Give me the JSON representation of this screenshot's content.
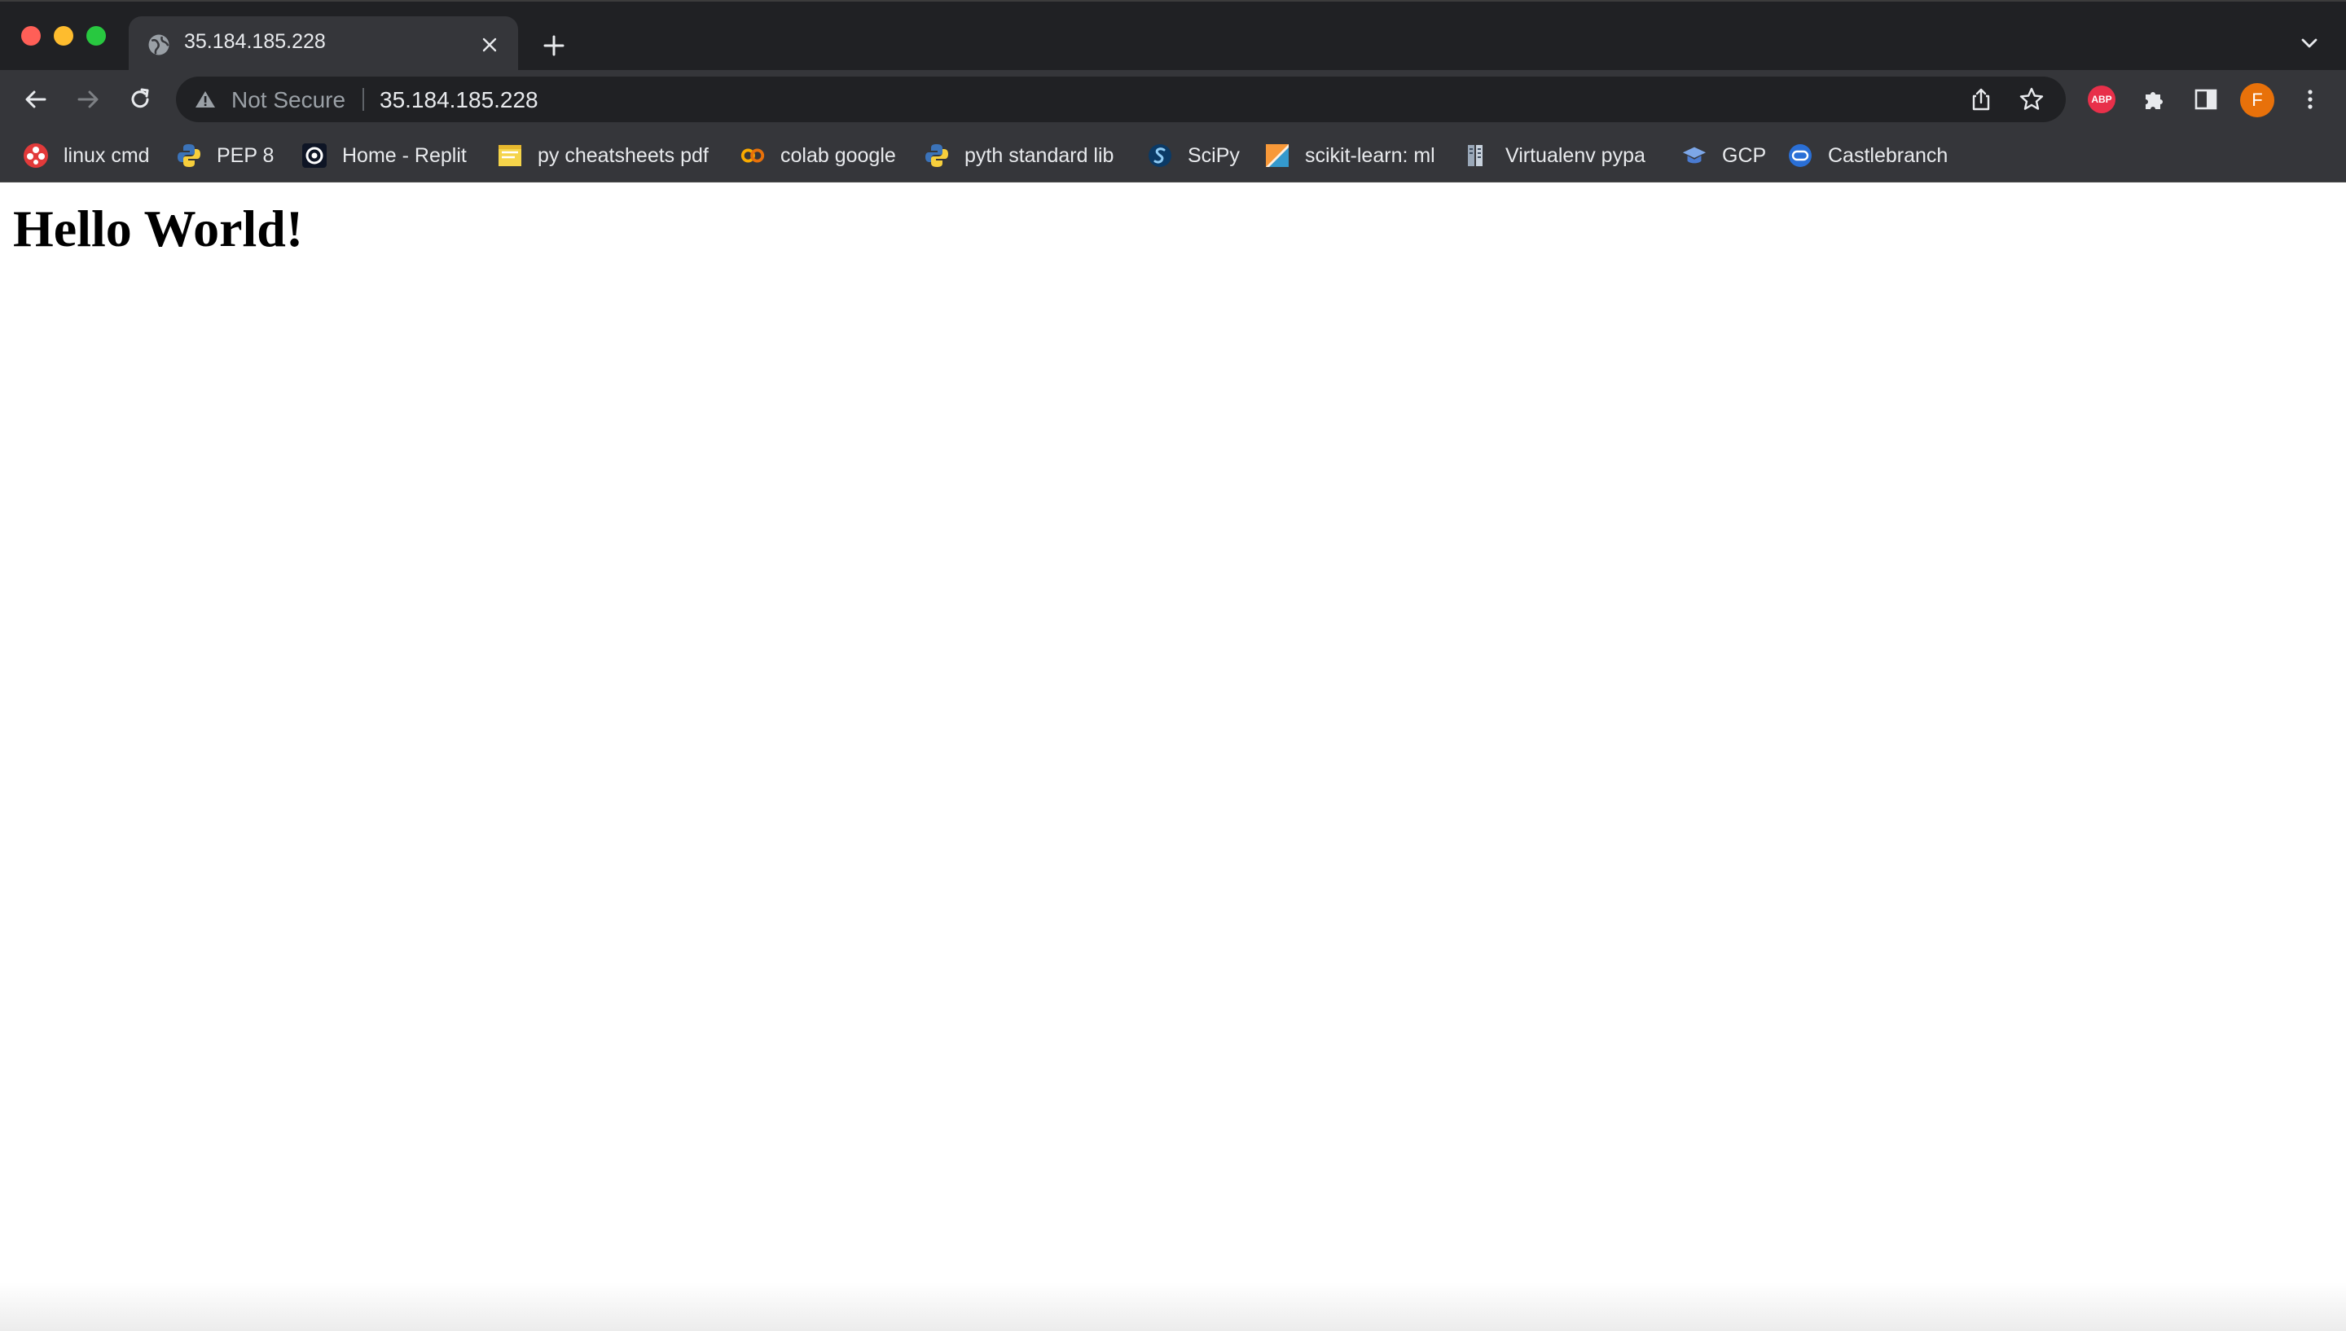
{
  "tab": {
    "title": "35.184.185.228"
  },
  "toolbar": {
    "security_label": "Not Secure",
    "url": "35.184.185.228",
    "extension_abp": "ABP",
    "profile_initial": "F"
  },
  "bookmarks": [
    {
      "label": "linux cmd",
      "icon": "red-flower-icon"
    },
    {
      "label": "PEP 8",
      "icon": "python-icon"
    },
    {
      "label": "Home - Replit",
      "icon": "replit-icon"
    },
    {
      "label": "py cheatsheets pdf",
      "icon": "cheatsheet-icon"
    },
    {
      "label": "colab google",
      "icon": "colab-icon"
    },
    {
      "label": "pyth standard lib",
      "icon": "python-icon"
    },
    {
      "label": "SciPy",
      "icon": "scipy-icon"
    },
    {
      "label": "scikit-learn: ml",
      "icon": "sklearn-icon"
    },
    {
      "label": "Virtualenv pypa",
      "icon": "pypa-icon"
    },
    {
      "label": "GCP",
      "icon": "gcp-icon"
    },
    {
      "label": "Castlebranch",
      "icon": "castlebranch-icon"
    }
  ],
  "page": {
    "heading": "Hello World!"
  },
  "colors": {
    "tabstrip": "#202124",
    "toolbar": "#35363a",
    "omnibox": "#202124",
    "avatar": "#e8710a",
    "abp": "#e8304a"
  }
}
